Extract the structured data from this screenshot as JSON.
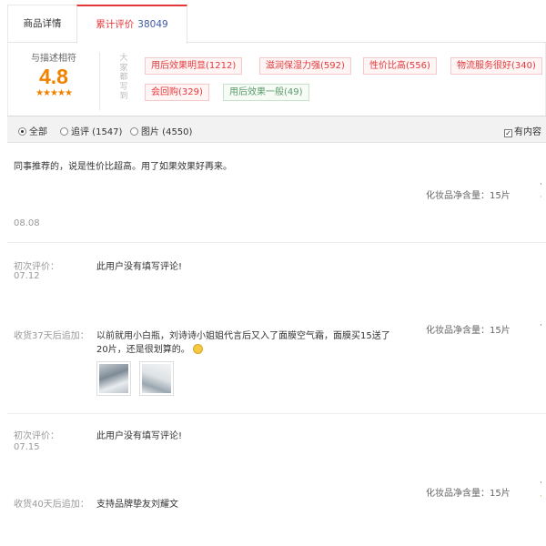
{
  "tabs": [
    {
      "label": "商品详情"
    },
    {
      "label": "累计评价",
      "count": "38049"
    }
  ],
  "summary": {
    "rating_label": "与描述相符",
    "score": "4.8",
    "stars": "★★★★★",
    "vertical_label": "大家都写到",
    "tags": [
      {
        "label": "用后效果明显(1212)",
        "color": "red"
      },
      {
        "label": "滋润保湿力强(592)",
        "color": "red"
      },
      {
        "label": "性价比高(556)",
        "color": "red"
      },
      {
        "label": "物流服务很好(340)",
        "color": "red"
      },
      {
        "label": "会回购(329)",
        "color": "red"
      },
      {
        "label": "用后效果一般(49)",
        "color": "green"
      }
    ]
  },
  "filters": {
    "all": "全部",
    "append": "追评 (1547)",
    "pictures": "图片 (4550)",
    "has_content": "有内容"
  },
  "reviews": [
    {
      "text": "同事推荐的，说是性价比超高。用了如果效果好再来。",
      "spec": "化妆品净含量：15片",
      "date": "08.08"
    },
    {
      "initial_label": "初次评价：",
      "initial_date": "07.12",
      "initial_text": "此用户没有填写评论!",
      "append_label": "收货37天后追加：",
      "append_text_line1": "以前就用小白瓶，刘诗诗小姐姐代言后又入了面膜空气霜，面膜买15送了",
      "append_text_line2": "20片，还是很划算的。",
      "spec": "化妆品净含量：15片"
    },
    {
      "initial_label": "初次评价：",
      "initial_date": "07.15",
      "initial_text": "此用户没有填写评论!",
      "append_label": "收货40天后追加：",
      "append_text": "支持品牌挚友刘耀文",
      "spec": "化妆品净含量：15片"
    }
  ],
  "colors": {
    "accent": "#e4393c",
    "rating": "#f08200",
    "count": "#3d5aa8",
    "tag_green": "#5a9a6a"
  }
}
